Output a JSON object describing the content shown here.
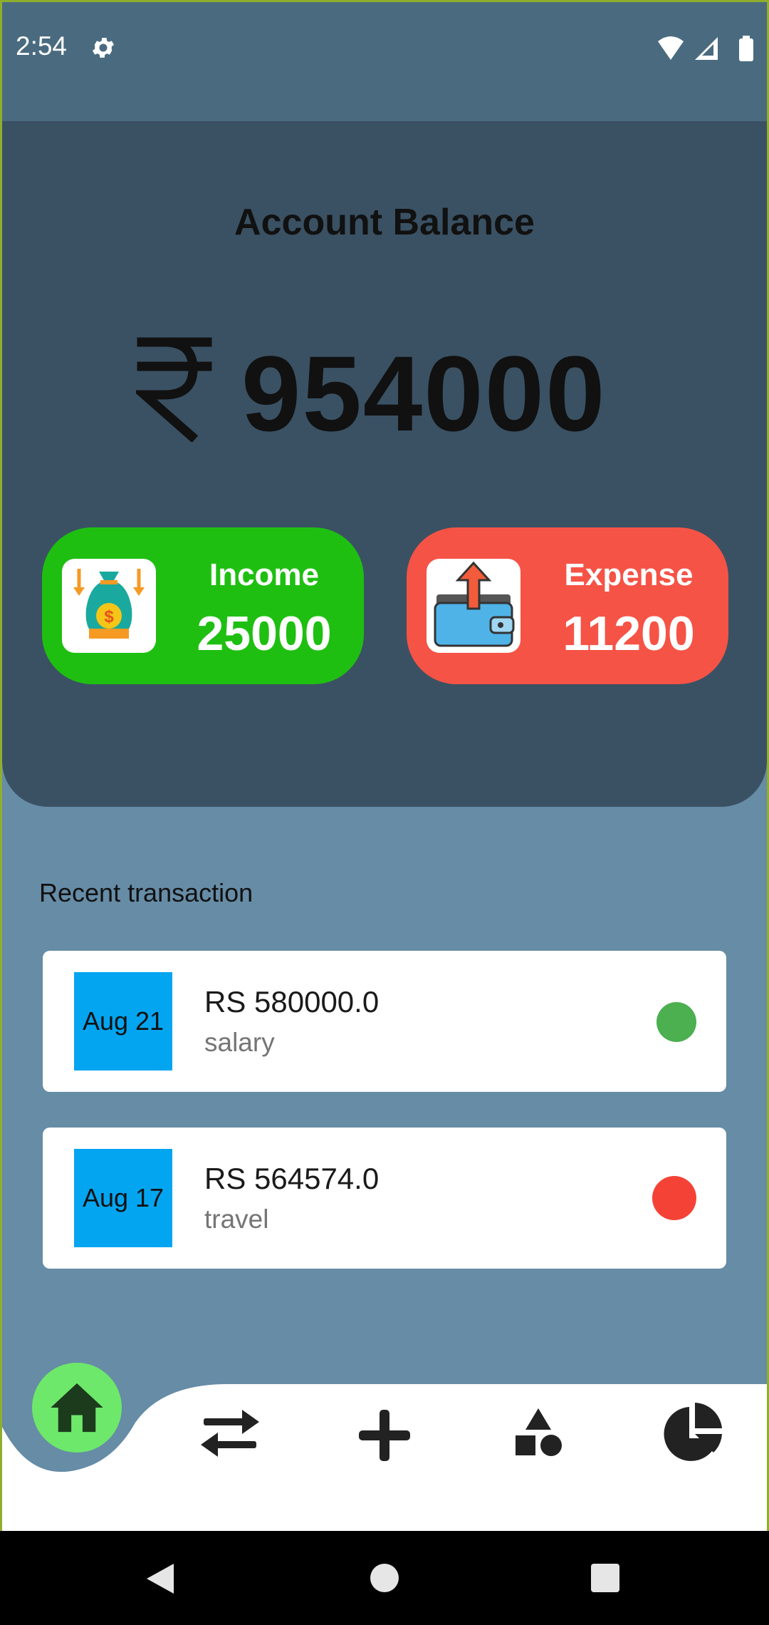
{
  "status_bar": {
    "time": "2:54",
    "icons": [
      "gear-icon",
      "wifi-icon",
      "signal-icon",
      "battery-icon"
    ]
  },
  "balance": {
    "title": "Account Balance",
    "currency_icon": "rupee-icon",
    "amount": "954000"
  },
  "income_card": {
    "label": "Income",
    "value": "25000",
    "icon": "money-bag-icon",
    "color": "#1fbf12"
  },
  "expense_card": {
    "label": "Expense",
    "value": "11200",
    "icon": "wallet-icon",
    "color": "#f55346"
  },
  "recent": {
    "title": "Recent transaction",
    "transactions": [
      {
        "date": "Aug 21",
        "amount": "RS 580000.0",
        "category": "salary",
        "type": "income",
        "color": "#4caf50"
      },
      {
        "date": "Aug 17",
        "amount": "RS 564574.0",
        "category": "travel",
        "type": "expense",
        "color": "#f44336"
      }
    ]
  },
  "bottom_nav": {
    "items": [
      "home-icon",
      "transfer-icon",
      "add-icon",
      "categories-icon",
      "pie-chart-icon"
    ],
    "active": "home-icon",
    "active_color": "#6ee86b"
  },
  "system_nav": [
    "back-icon",
    "home-circle-icon",
    "recents-icon"
  ]
}
